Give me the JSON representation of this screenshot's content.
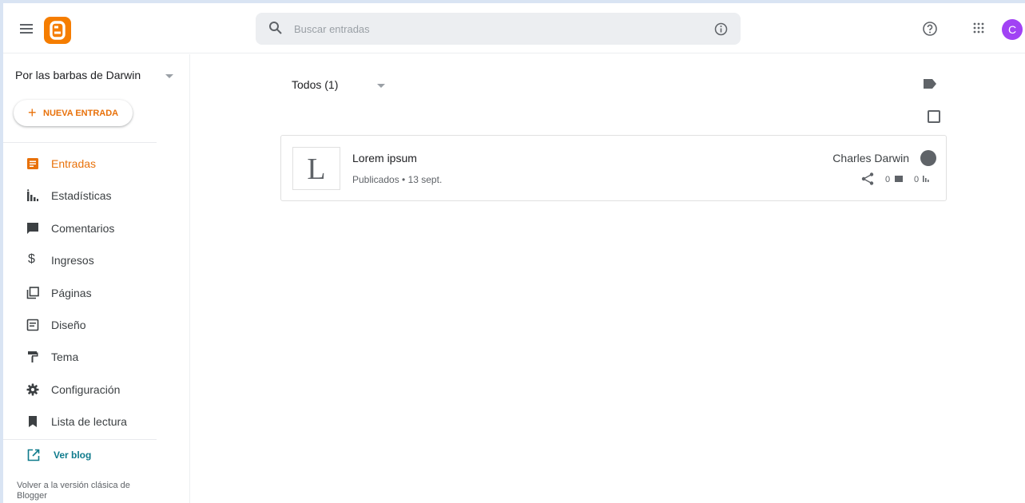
{
  "header": {
    "search_placeholder": "Buscar entradas",
    "avatar_letter": "C"
  },
  "sidebar": {
    "blog_name": "Por las barbas de Darwin",
    "new_post_label": "NUEVA ENTRADA",
    "items": [
      {
        "label": "Entradas",
        "icon": "posts-icon",
        "active": true
      },
      {
        "label": "Estadísticas",
        "icon": "stats-icon",
        "active": false
      },
      {
        "label": "Comentarios",
        "icon": "comment-icon",
        "active": false
      },
      {
        "label": "Ingresos",
        "icon": "dollar-icon",
        "active": false
      },
      {
        "label": "Páginas",
        "icon": "pages-icon",
        "active": false
      },
      {
        "label": "Diseño",
        "icon": "layout-icon",
        "active": false
      },
      {
        "label": "Tema",
        "icon": "paint-roller-icon",
        "active": false
      },
      {
        "label": "Configuración",
        "icon": "gear-icon",
        "active": false
      },
      {
        "label": "Lista de lectura",
        "icon": "bookmark-icon",
        "active": false
      }
    ],
    "view_blog_label": "Ver blog",
    "classic_link": "Volver a la versión clásica de Blogger"
  },
  "main": {
    "filter_label": "Todos (1)",
    "posts": [
      {
        "thumb_letter": "L",
        "title": "Lorem ipsum",
        "meta": "Publicados • 13 sept.",
        "author": "Charles Darwin",
        "comments": "0",
        "views": "0"
      }
    ]
  },
  "colors": {
    "accent": "#e8710a",
    "logo": "#f57d00",
    "avatar": "#a142f4",
    "view_blog": "#0f7b8c"
  }
}
